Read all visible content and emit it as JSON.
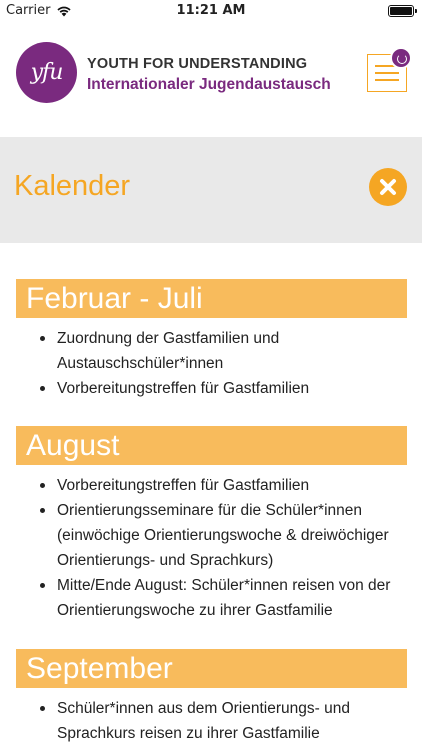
{
  "status_bar": {
    "carrier": "Carrier",
    "time": "11:21 AM",
    "icons": [
      "wifi-icon",
      "battery-icon"
    ]
  },
  "header": {
    "logo_text": "yfu",
    "title": "YOUTH FOR UNDERSTANDING",
    "subtitle": "Internationaler Jugendaustausch",
    "menu_icon": "hamburger-menu-icon",
    "badge_icon": "refresh-badge-icon"
  },
  "page": {
    "title": "Kalender",
    "close_icon": "close-icon"
  },
  "colors": {
    "accent": "#f5a623",
    "section_header": "#f8bb5c",
    "brand_purple": "#7a2a7f",
    "title_band": "#e9e9e9"
  },
  "sections": [
    {
      "heading": "Februar - Juli",
      "items": [
        "Zuordnung der Gastfamilien und Austauschschüler*innen",
        "Vorbereitungstreffen für Gastfamilien"
      ]
    },
    {
      "heading": "August",
      "items": [
        "Vorbereitungstreffen für Gastfamilien",
        "Orientierungsseminare für die Schüler*innen (einwöchige Orientierungswoche & dreiwöchiger Orientierungs- und Sprachkurs)",
        "Mitte/Ende August: Schüler*innen reisen von der Orientierungswoche zu ihrer Gastfamilie"
      ]
    },
    {
      "heading": "September",
      "items": [
        "Schüler*innen aus dem Orientierungs- und Sprachkurs reisen zu ihrer Gastfamilie"
      ]
    }
  ]
}
